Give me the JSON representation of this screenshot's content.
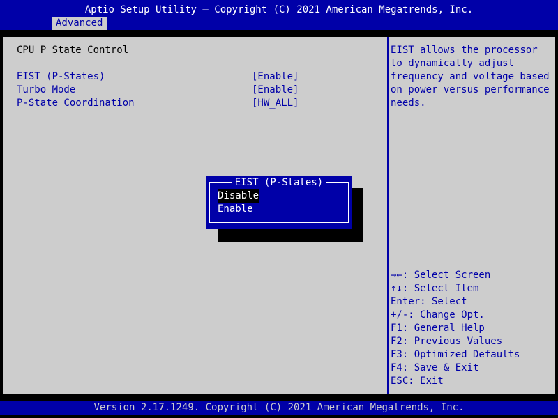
{
  "header": {
    "title": "Aptio Setup Utility – Copyright (C) 2021 American Megatrends, Inc.",
    "tabs": [
      "Advanced"
    ]
  },
  "main": {
    "section_title": "CPU P State Control",
    "settings": [
      {
        "label": "EIST (P-States)",
        "value": "[Enable]"
      },
      {
        "label": "Turbo Mode",
        "value": "[Enable]"
      },
      {
        "label": "P-State Coordination",
        "value": "[HW_ALL]"
      }
    ]
  },
  "help": {
    "lines": [
      "EIST allows the processor",
      "to dynamically adjust",
      "frequency and voltage based",
      "on power versus performance",
      "needs."
    ]
  },
  "keys": [
    "→←: Select Screen",
    "↑↓: Select Item",
    "Enter: Select",
    "+/-: Change Opt.",
    "F1: General Help",
    "F2: Previous Values",
    "F3: Optimized Defaults",
    "F4: Save & Exit",
    "ESC: Exit"
  ],
  "popup": {
    "title": "EIST (P-States)",
    "options": [
      "Disable",
      "Enable"
    ],
    "selected": "Disable"
  },
  "footer": {
    "text": "Version 2.17.1249. Copyright (C) 2021 American Megatrends, Inc."
  },
  "colors": {
    "bios_blue": "#0000a8",
    "panel_gray": "#cdcdcd",
    "text_white": "#ffffff",
    "text_black": "#000000"
  }
}
